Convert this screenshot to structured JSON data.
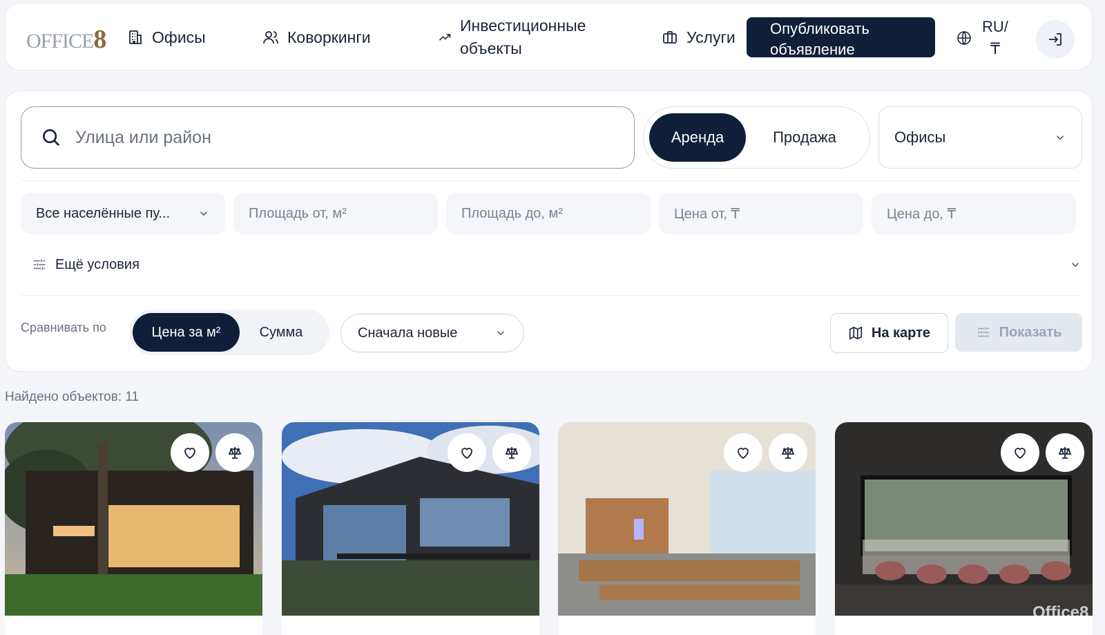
{
  "header": {
    "logo_text": "OFFICE",
    "logo_eight": "8",
    "nav": [
      {
        "label": "Офисы",
        "icon": "building-icon"
      },
      {
        "label": "Коворкинги",
        "icon": "users-icon"
      },
      {
        "label_line1": "Инвестиционные",
        "label_line2": "объекты",
        "icon": "trend-up-icon"
      },
      {
        "label": "Услуги",
        "icon": "briefcase-icon"
      }
    ],
    "publish_line1": "Опубликовать",
    "publish_line2": "объявление",
    "lang_line1": "RU/",
    "lang_line2": "₸"
  },
  "search": {
    "value": "",
    "placeholder": "Улица или район"
  },
  "deal": {
    "options": [
      "Аренда",
      "Продажа"
    ],
    "selected": "Аренда"
  },
  "property_type": {
    "selected": "Офисы"
  },
  "fields": {
    "city": "Все населённые пу...",
    "area_from": "Площадь от, м²",
    "area_to": "Площадь до, м²",
    "price_from": "Цена от, ₸",
    "price_to": "Цена до, ₸"
  },
  "more_conditions": "Ещё условия",
  "compare": {
    "label": "Сравнивать по",
    "options": [
      "Цена за м²",
      "Сумма"
    ],
    "selected": "Цена за м²"
  },
  "sort": {
    "selected": "Сначала новые"
  },
  "buttons": {
    "map": "На карте",
    "show": "Показать"
  },
  "results": {
    "found_text": "Найдено объектов: 11"
  },
  "watermark": "Office8",
  "colors": {
    "primary": "#0f1f3a",
    "background": "#f3f5f8",
    "muted_text": "#6a7180"
  }
}
